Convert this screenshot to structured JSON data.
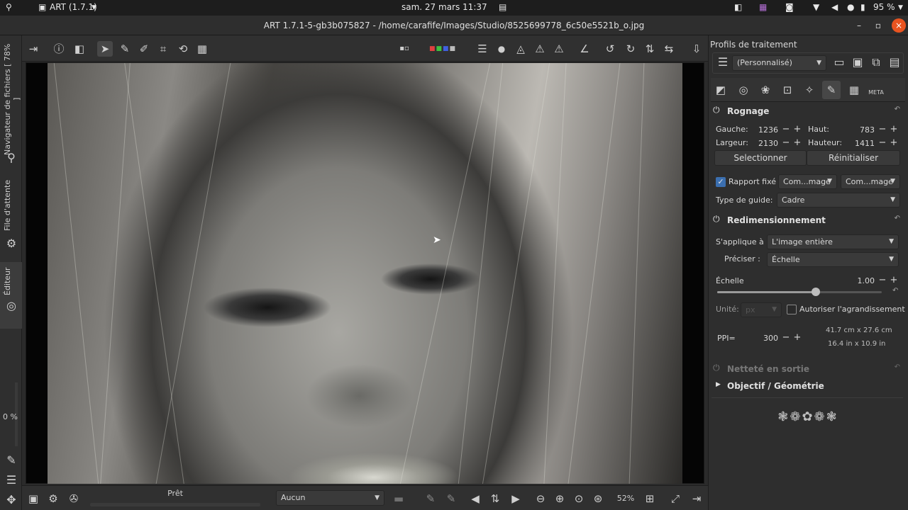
{
  "os_bar": {
    "app_menu": "ART (1.7.1)",
    "clock": "sam. 27 mars  11:37",
    "battery": "95 %"
  },
  "window": {
    "title": "ART 1.7.1-5-gb3b075827 - /home/carafife/Images/Studio/8525699778_6c50e5521b_o.jpg",
    "minimize": "–",
    "maximize": "▫",
    "close": "×"
  },
  "left_tabs": {
    "browser": "Navigateur de fichiers  [ 78% ]",
    "queue": "File d'attente",
    "editor": "Éditeur"
  },
  "left_status": {
    "percent": "0 %"
  },
  "bottom": {
    "status": "Prêt",
    "preview_mode": "Aucun",
    "zoom": "52%"
  },
  "panel": {
    "profiles_title": "Profils de traitement",
    "profile_value": "(Personnalisé)",
    "crop": {
      "title": "Rognage",
      "left_label": "Gauche:",
      "left_value": "1236",
      "top_label": "Haut:",
      "top_value": "783",
      "width_label": "Largeur:",
      "width_value": "2130",
      "height_label": "Hauteur:",
      "height_value": "1411",
      "select_button": "Selectionner",
      "reset_button": "Réinitialiser",
      "fixed_ratio_label": "Rapport fixé",
      "ratio_combo1": "Com...mage",
      "ratio_combo2": "Com...mage",
      "guide_label": "Type de guide:",
      "guide_value": "Cadre"
    },
    "resize": {
      "title": "Redimensionnement",
      "applies_label": "S'applique à :",
      "applies_value": "L'image entière",
      "specify_label": "Préciser :",
      "specify_value": "Échelle",
      "scale_label": "Échelle",
      "scale_value": "1.00",
      "scale_slider_fraction": 0.6,
      "unit_label": "Unité:",
      "unit_value": "px",
      "allow_upscale_label": "Autoriser l'agrandissement",
      "ppi_label": "PPI=",
      "ppi_value": "300",
      "size_cm": "41.7 cm x 27.6 cm",
      "size_in": "16.4 in x 10.9 in"
    },
    "sharpening": {
      "title": "Netteté en sortie"
    },
    "lens": {
      "title": "Objectif / Géométrie"
    },
    "tabs": [
      "exposure",
      "detail",
      "color",
      "advanced",
      "effects",
      "transform",
      "raw",
      "meta"
    ],
    "meta_tab_label": "META"
  },
  "colors": {
    "accent": "#e95420",
    "panel_bg": "#2e2e2e",
    "active_tab": "#474747"
  }
}
